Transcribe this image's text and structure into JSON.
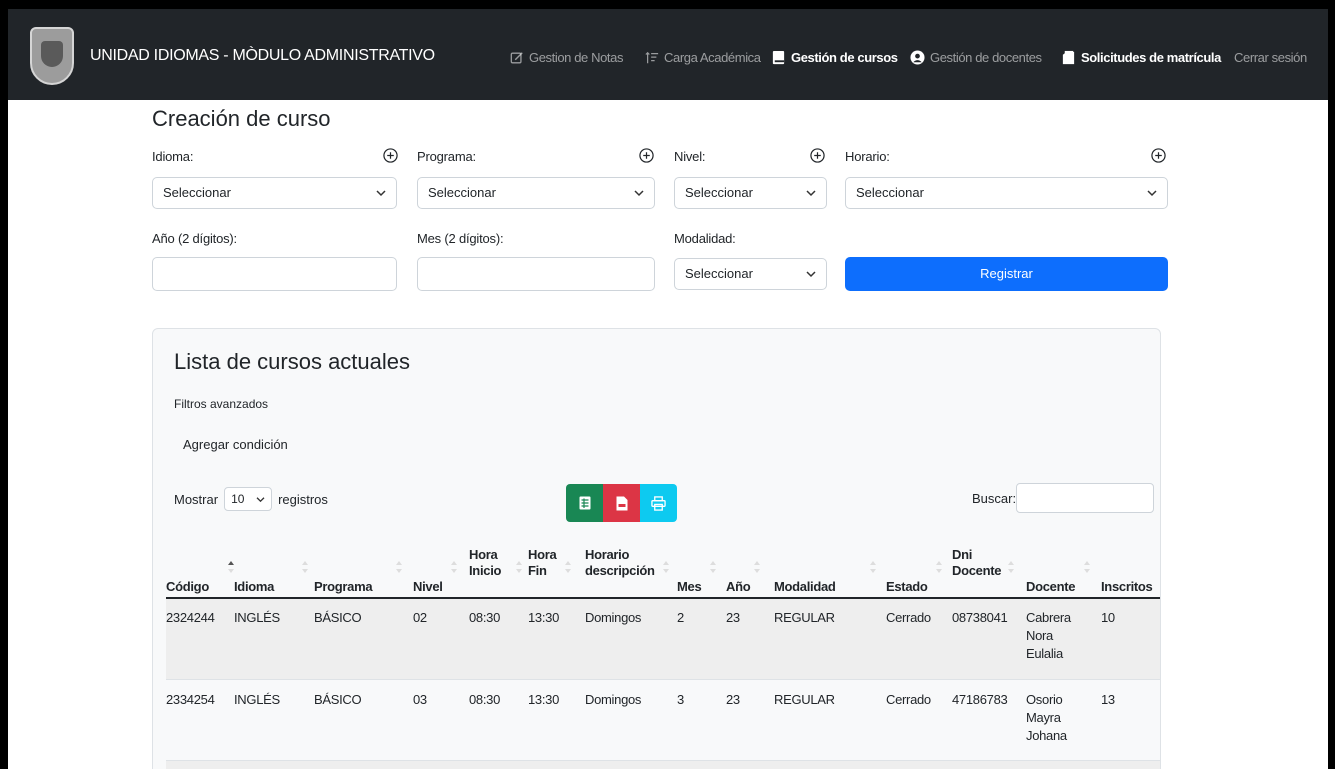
{
  "navbar": {
    "brand": "UNIDAD IDIOMAS - MÒDULO ADMINISTRATIVO",
    "items": [
      {
        "label": "Gestion de Notas",
        "icon": "edit-icon",
        "active": false
      },
      {
        "label": "Carga Académica",
        "icon": "sort-list-icon",
        "active": false
      },
      {
        "label": "Gestión de cursos",
        "icon": "book-icon",
        "active": true
      },
      {
        "label": "Gestión de docentes",
        "icon": "user-circle-icon",
        "active": false
      },
      {
        "label": "Solicitudes de matrícula",
        "icon": "folder-icon",
        "active": false
      },
      {
        "label": "Cerrar sesión",
        "icon": "",
        "active": false
      }
    ]
  },
  "form": {
    "title": "Creación de curso",
    "idioma_label": "Idioma:",
    "programa_label": "Programa:",
    "nivel_label": "Nivel:",
    "horario_label": "Horario:",
    "select_default": "Seleccionar",
    "anio_label": "Año (2 dígitos):",
    "mes_label": "Mes (2 dígitos):",
    "modalidad_label": "Modalidad:",
    "register_label": "Registrar"
  },
  "list": {
    "title": "Lista de cursos actuales",
    "filtros": "Filtros avanzados",
    "agregar": "Agregar condición",
    "mostrar": "Mostrar",
    "page_length": "10",
    "registros": "registros",
    "buscar": "Buscar:",
    "columns": [
      "Código",
      "Idioma",
      "Programa",
      "Nivel",
      "Hora Inicio",
      "Hora Fin",
      "Horario descripción",
      "Mes",
      "Año",
      "Modalidad",
      "Estado",
      "Dni Docente",
      "Docente",
      "Inscritos"
    ],
    "rows": [
      {
        "codigo": "2324244",
        "idioma": "INGLÉS",
        "programa": "BÁSICO",
        "nivel": "02",
        "hora_inicio": "08:30",
        "hora_fin": "13:30",
        "horario": "Domingos",
        "mes": "2",
        "anio": "23",
        "modalidad": "REGULAR",
        "estado": "Cerrado",
        "dni": "08738041",
        "docente": "Cabrera Nora Eulalia",
        "inscritos": "10"
      },
      {
        "codigo": "2334254",
        "idioma": "INGLÉS",
        "programa": "BÁSICO",
        "nivel": "03",
        "hora_inicio": "08:30",
        "hora_fin": "13:30",
        "horario": "Domingos",
        "mes": "3",
        "anio": "23",
        "modalidad": "REGULAR",
        "estado": "Cerrado",
        "dni": "47186783",
        "docente": "Osorio Mayra Johana",
        "inscritos": "13"
      }
    ]
  },
  "colors": {
    "navbar": "#212529",
    "primary": "#0d6efd",
    "excel": "#198754",
    "pdf": "#dc3545",
    "print": "#0dcaf0"
  }
}
